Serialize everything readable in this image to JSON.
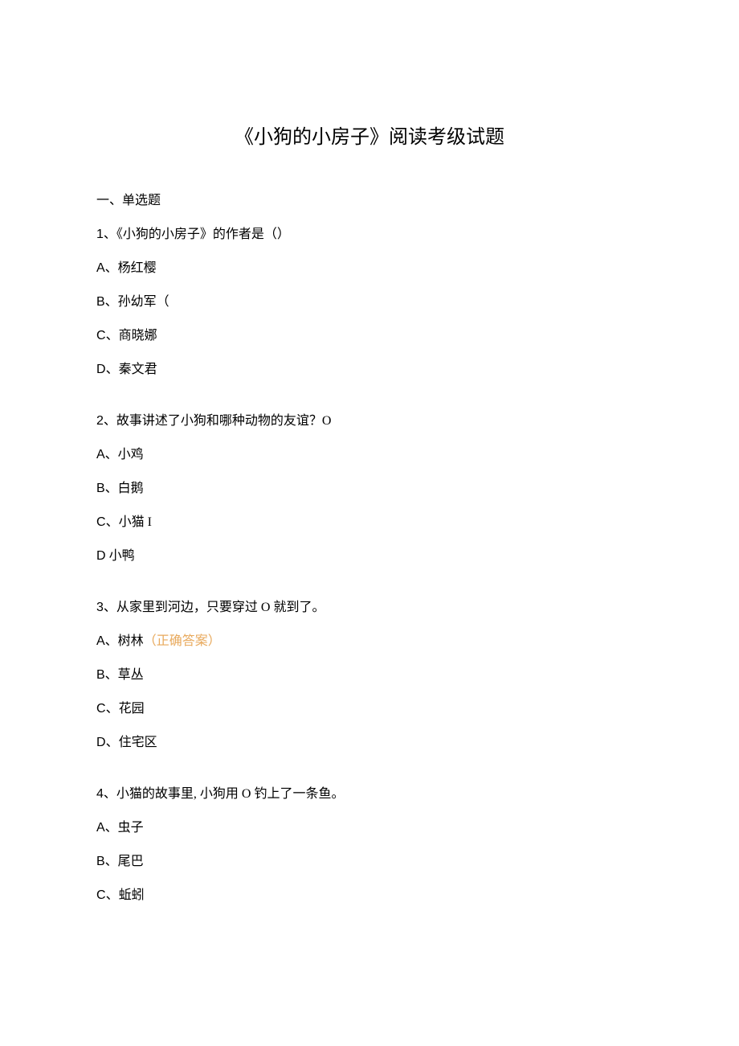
{
  "title": "《小狗的小房子》阅读考级试题",
  "sectionHeading": "一、单选题",
  "questions": [
    {
      "number": "1",
      "text": "、《小狗的小房子》的作者是（）",
      "options": [
        {
          "letter": "A",
          "text": "、杨红樱",
          "correct": false
        },
        {
          "letter": "B",
          "text": "、孙幼军（",
          "correct": false
        },
        {
          "letter": "C",
          "text": "、商晓娜",
          "correct": false
        },
        {
          "letter": "D",
          "text": "、秦文君",
          "correct": false
        }
      ]
    },
    {
      "number": "2",
      "text": "、故事讲述了小狗和哪种动物的友谊？O",
      "options": [
        {
          "letter": "A",
          "text": "、小鸡",
          "correct": false
        },
        {
          "letter": "B",
          "text": "、白鹅",
          "correct": false
        },
        {
          "letter": "C",
          "text": "、小猫 I",
          "correct": false
        },
        {
          "letter": "D",
          "text": " 小鸭",
          "correct": false
        }
      ]
    },
    {
      "number": "3",
      "text": "、从家里到河边，只要穿过 O 就到了。",
      "options": [
        {
          "letter": "A",
          "text": "、树林",
          "correct": true,
          "correctLabel": "（正确答案）"
        },
        {
          "letter": "B",
          "text": "、草丛",
          "correct": false
        },
        {
          "letter": "C",
          "text": "、花园",
          "correct": false
        },
        {
          "letter": "D",
          "text": "、住宅区",
          "correct": false
        }
      ]
    },
    {
      "number": "4",
      "text": "、小猫的故事里, 小狗用 O 钓上了一条鱼。",
      "options": [
        {
          "letter": "A",
          "text": "、虫子",
          "correct": false
        },
        {
          "letter": "B",
          "text": "、尾巴",
          "correct": false
        },
        {
          "letter": "C",
          "text": "、蚯蚓",
          "correct": false
        }
      ]
    }
  ]
}
